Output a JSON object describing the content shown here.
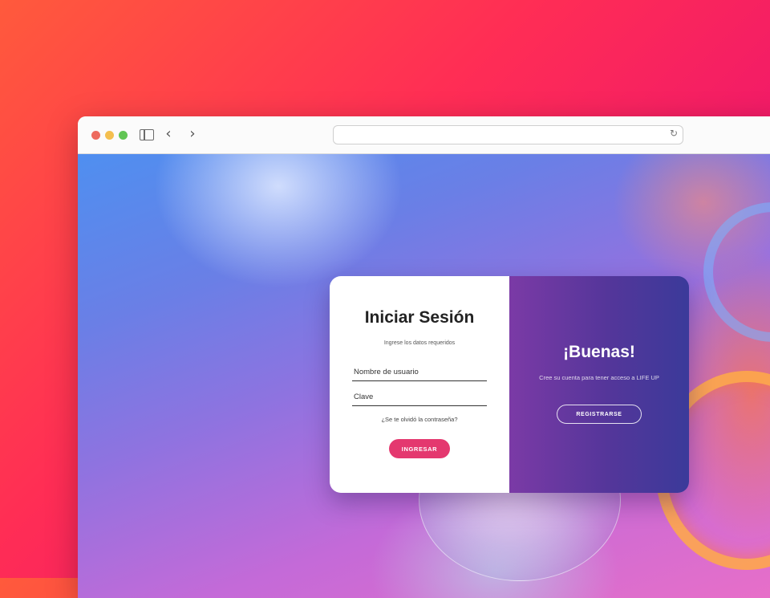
{
  "browser": {
    "back_icon": "‹",
    "forward_icon": "›",
    "reload_icon": "↻",
    "url": ""
  },
  "login": {
    "title": "Iniciar Sesión",
    "subtitle": "Ingrese los datos requeridos",
    "username_placeholder": "Nombre de usuario",
    "password_placeholder": "Clave",
    "forgot_link": "¿Se te olvidó la contraseña?",
    "submit_label": "INGRESAR"
  },
  "welcome": {
    "title": "¡Buenas!",
    "text": "Cree su cuenta para tener acceso a LIFE UP",
    "register_label": "REGISTRARSE"
  },
  "colors": {
    "accent_pink": "#e4386f",
    "panel_purple": "#54369a",
    "background_gradient_start": "#ff5a3c",
    "background_gradient_end": "#e01a8a"
  }
}
